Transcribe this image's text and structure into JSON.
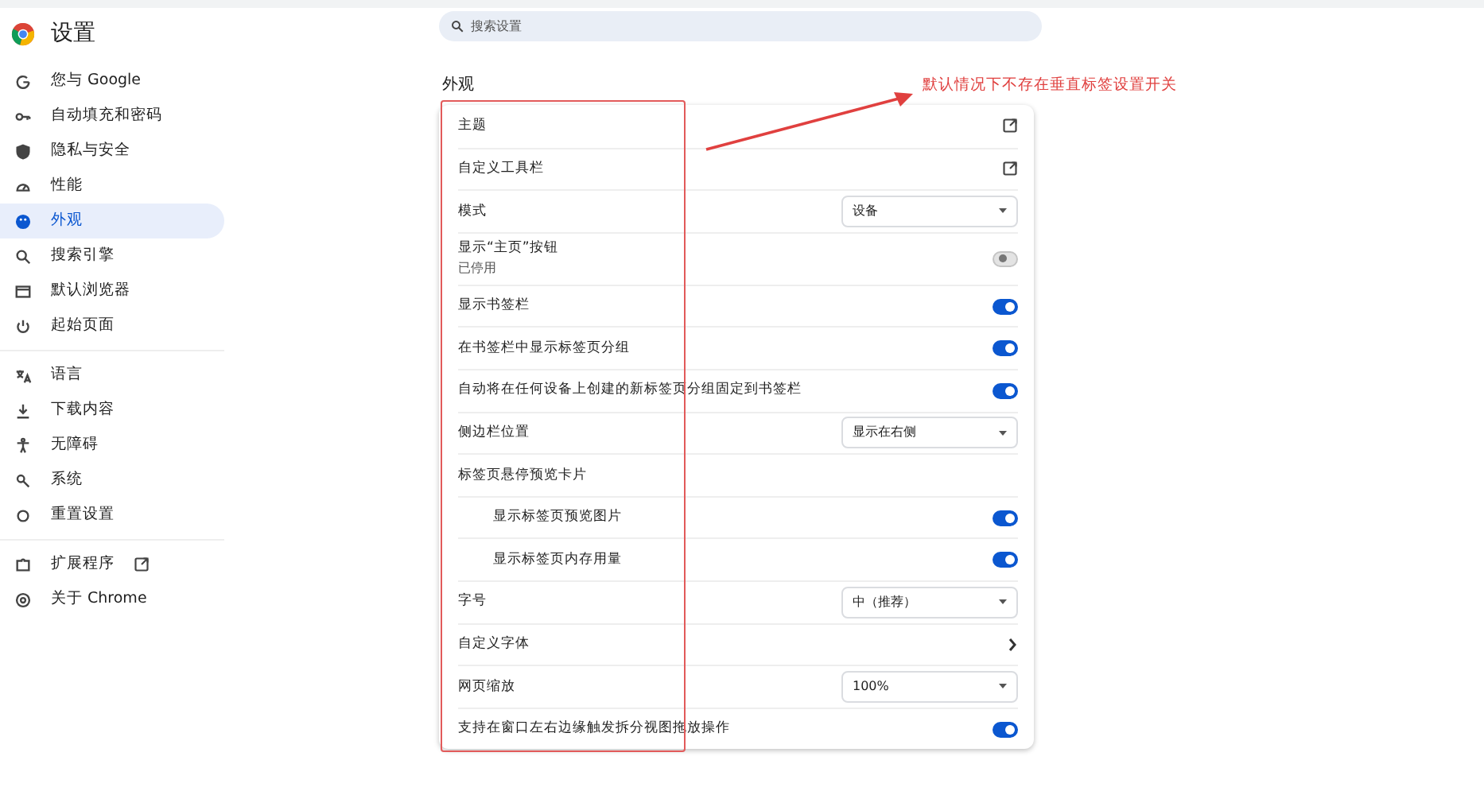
{
  "header": {
    "title": "设置"
  },
  "sidebar": {
    "groups": [
      [
        {
          "label": "您与 Google",
          "selected": false
        },
        {
          "label": "自动填充和密码",
          "selected": false
        },
        {
          "label": "隐私与安全",
          "selected": false
        },
        {
          "label": "性能",
          "selected": false
        },
        {
          "label": "外观",
          "selected": true
        },
        {
          "label": "搜索引擎",
          "selected": false
        },
        {
          "label": "默认浏览器",
          "selected": false
        },
        {
          "label": "起始页面",
          "selected": false
        }
      ],
      [
        {
          "label": "语言",
          "selected": false
        },
        {
          "label": "下载内容",
          "selected": false
        },
        {
          "label": "无障碍",
          "selected": false
        },
        {
          "label": "系统",
          "selected": false
        },
        {
          "label": "重置设置",
          "selected": false
        }
      ],
      [
        {
          "label": "扩展程序",
          "selected": false,
          "external": true
        },
        {
          "label": "关于 Chrome",
          "selected": false
        }
      ]
    ]
  },
  "search": {
    "placeholder": "搜索设置"
  },
  "section": {
    "title": "外观"
  },
  "settings": [
    {
      "kind": "link",
      "label": "主题"
    },
    {
      "kind": "link",
      "label": "自定义工具栏"
    },
    {
      "kind": "select",
      "label": "模式",
      "value": "设备"
    },
    {
      "kind": "toggle",
      "label": "显示“主页”按钮",
      "sublabel": "已停用",
      "on": false
    },
    {
      "kind": "toggle",
      "label": "显示书签栏",
      "on": true
    },
    {
      "kind": "toggle",
      "label": "在书签栏中显示标签页分组",
      "on": true
    },
    {
      "kind": "toggle",
      "label": "自动将在任何设备上创建的新标签页分组固定到书签栏",
      "on": true
    },
    {
      "kind": "select",
      "label": "侧边栏位置",
      "value": "显示在右侧"
    },
    {
      "kind": "heading",
      "label": "标签页悬停预览卡片"
    },
    {
      "kind": "subtoggle",
      "label": "显示标签页预览图片",
      "on": true
    },
    {
      "kind": "subtoggle",
      "label": "显示标签页内存用量",
      "on": true
    },
    {
      "kind": "select",
      "label": "字号",
      "value": "中（推荐）"
    },
    {
      "kind": "chevron",
      "label": "自定义字体"
    },
    {
      "kind": "select",
      "label": "网页缩放",
      "value": "100%"
    },
    {
      "kind": "toggle",
      "label": "支持在窗口左右边缘触发拆分视图拖放操作",
      "on": true
    }
  ],
  "annotation": {
    "text": "默认情况下不存在垂直标签设置开关"
  }
}
